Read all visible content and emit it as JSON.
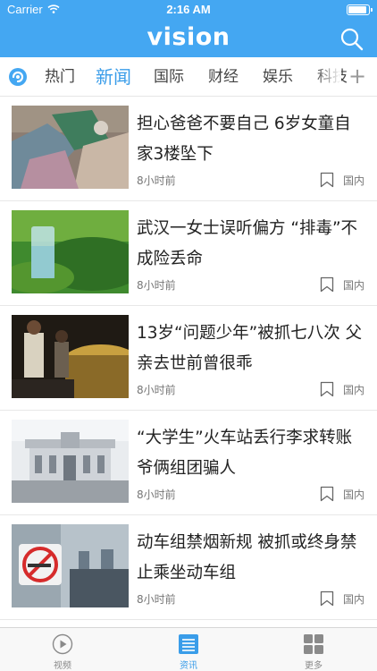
{
  "status_bar": {
    "carrier": "Carrier",
    "time": "2:16 AM"
  },
  "nav": {
    "logo_text": "vision"
  },
  "tabs": {
    "items": [
      {
        "label": "热门",
        "active": false
      },
      {
        "label": "新闻",
        "active": true
      },
      {
        "label": "国际",
        "active": false
      },
      {
        "label": "财经",
        "active": false
      },
      {
        "label": "娱乐",
        "active": false
      },
      {
        "label": "科技",
        "active": false
      }
    ],
    "add_label": "+"
  },
  "news": [
    {
      "title": "担心爸爸不要自己 6岁女童自家3楼坠下",
      "time": "8小时前",
      "category": "国内"
    },
    {
      "title": "武汉一女士误听偏方 “排毒”不成险丢命",
      "time": "8小时前",
      "category": "国内"
    },
    {
      "title": "13岁“问题少年”被抓七八次 父亲去世前曾很乖",
      "time": "8小时前",
      "category": "国内"
    },
    {
      "title": "“大学生”火车站丢行李求转账 爷俩组团骗人",
      "time": "8小时前",
      "category": "国内"
    },
    {
      "title": "动车组禁烟新规 被抓或终身禁止乘坐动车组",
      "time": "8小时前",
      "category": "国内"
    }
  ],
  "tabbar": {
    "items": [
      {
        "label": "视频",
        "icon": "play-circle-icon",
        "active": false
      },
      {
        "label": "资讯",
        "icon": "news-list-icon",
        "active": true
      },
      {
        "label": "更多",
        "icon": "grid-more-icon",
        "active": false
      }
    ]
  },
  "colors": {
    "brand": "#44a7f2",
    "active_tab": "#3a9de9",
    "title_text": "#222222",
    "meta_text": "#777777"
  }
}
